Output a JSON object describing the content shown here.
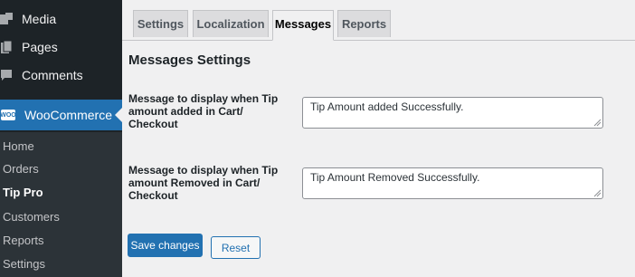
{
  "sidebar": {
    "top_items": [
      {
        "label": "Media",
        "icon": "media-icon"
      },
      {
        "label": "Pages",
        "icon": "pages-icon"
      },
      {
        "label": "Comments",
        "icon": "comments-icon"
      },
      {
        "label": "WooCommerce",
        "icon": "woocommerce-icon",
        "badge": "WOO"
      }
    ],
    "submenu": [
      {
        "label": "Home"
      },
      {
        "label": "Orders"
      },
      {
        "label": "Tip Pro"
      },
      {
        "label": "Customers"
      },
      {
        "label": "Reports"
      },
      {
        "label": "Settings"
      }
    ]
  },
  "tabs": [
    {
      "label": "Settings"
    },
    {
      "label": "Localization"
    },
    {
      "label": "Messages"
    },
    {
      "label": "Reports"
    }
  ],
  "main": {
    "title": "Messages Settings",
    "fields": [
      {
        "label_lines": [
          "Message to display when Tip",
          "amount added in Cart/",
          "Checkout"
        ],
        "value": "Tip Amount added Successfully."
      },
      {
        "label_lines": [
          "Message to display when Tip",
          "amount Removed in Cart/",
          "Checkout"
        ],
        "value": "Tip Amount Removed Successfully."
      }
    ],
    "save_label": "Save changes",
    "reset_label": "Reset"
  },
  "colors": {
    "sidebar_bg": "#1d2327",
    "submenu_bg": "#2c3338",
    "accent": "#2271b1",
    "page_bg": "#f0f0f1"
  }
}
